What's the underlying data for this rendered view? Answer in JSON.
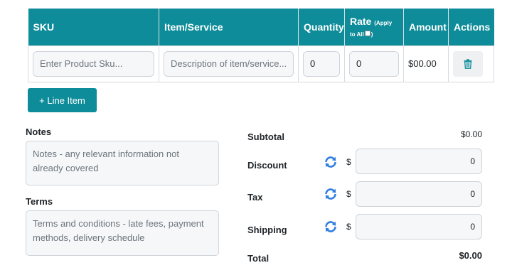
{
  "table": {
    "headers": {
      "sku": "SKU",
      "item": "Item/Service",
      "quantity": "Quantity",
      "rate": "Rate",
      "rate_note": "(Apply to All",
      "rate_note_end": ")",
      "amount": "Amount",
      "actions": "Actions"
    },
    "row": {
      "sku_placeholder": "Enter Product Sku...",
      "item_placeholder": "Description of item/service...",
      "quantity": "0",
      "rate": "0",
      "amount": "$00.00",
      "delete_icon": "trash-icon"
    }
  },
  "add_line_item": "+ Line Item",
  "notes": {
    "label": "Notes",
    "placeholder": "Notes - any relevant information not already covered"
  },
  "terms": {
    "label": "Terms",
    "placeholder": "Terms and conditions - late fees, payment methods, delivery schedule"
  },
  "summary": {
    "subtotal_label": "Subtotal",
    "subtotal_value": "$0.00",
    "discount_label": "Discount",
    "discount_value": "0",
    "tax_label": "Tax",
    "tax_value": "0",
    "shipping_label": "Shipping",
    "shipping_value": "0",
    "currency_symbol": "$",
    "toggle_icon": "cycle-icon",
    "total_label": "Total",
    "total_value": "$0.00"
  },
  "colors": {
    "header_bg": "#0e8c99",
    "accent_blue": "#2f7fe0",
    "trash": "#0e8c99"
  }
}
